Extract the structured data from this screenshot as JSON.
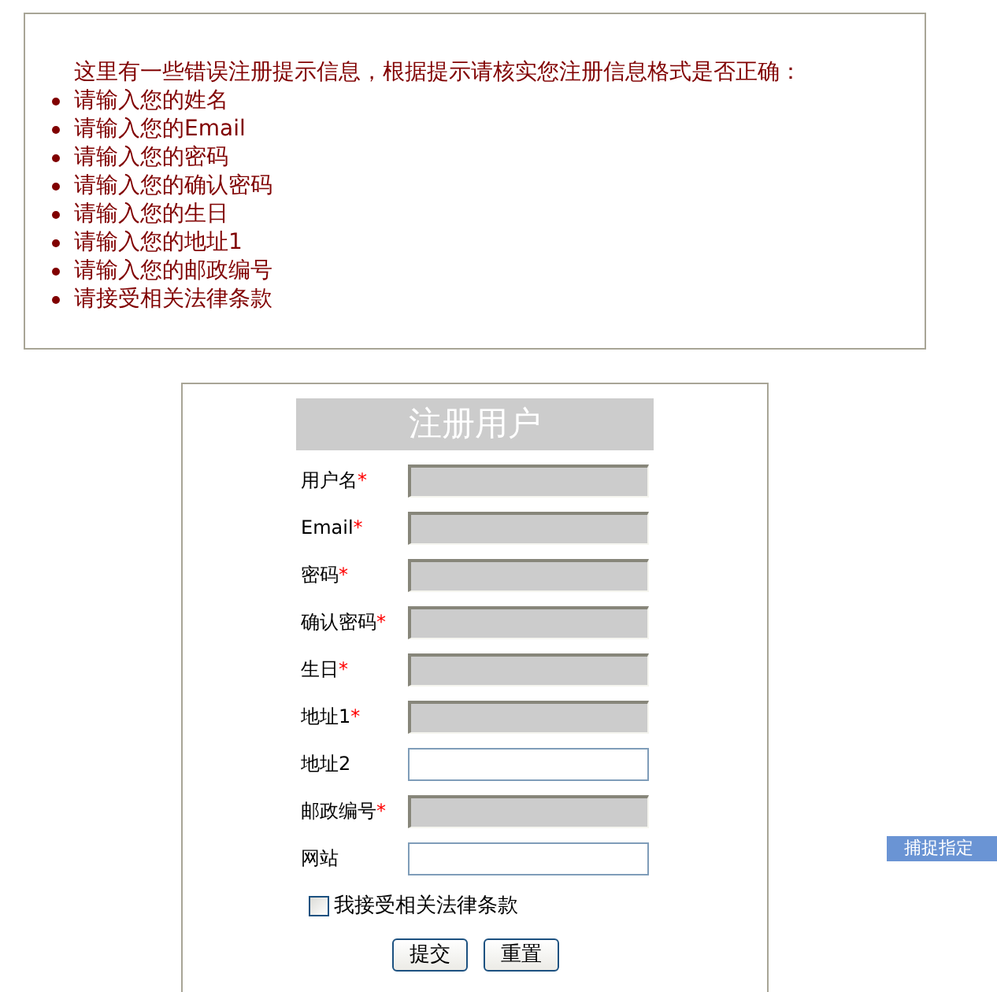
{
  "errors": {
    "intro": "这里有一些错误注册提示信息，根据提示请核实您注册信息格式是否正确：",
    "items": [
      "请输入您的姓名",
      "请输入您的Email",
      "请输入您的密码",
      "请输入您的确认密码",
      "请输入您的生日",
      "请输入您的地址1",
      "请输入您的邮政编号",
      "请接受相关法律条款"
    ]
  },
  "form": {
    "title": "注册用户",
    "fields": [
      {
        "label": "用户名",
        "required": true,
        "error": true
      },
      {
        "label": "Email",
        "required": true,
        "error": true
      },
      {
        "label": "密码",
        "required": true,
        "error": true
      },
      {
        "label": "确认密码",
        "required": true,
        "error": true
      },
      {
        "label": "生日",
        "required": true,
        "error": true
      },
      {
        "label": "地址1",
        "required": true,
        "error": true
      },
      {
        "label": "地址2",
        "required": false,
        "error": false
      },
      {
        "label": "邮政编号",
        "required": true,
        "error": true
      },
      {
        "label": "网站",
        "required": false,
        "error": false
      }
    ],
    "required_mark": "*",
    "agree": {
      "label": "我接受相关法律条款",
      "checked": false
    },
    "buttons": [
      "提交",
      "重置"
    ]
  },
  "capture_button": "捕捉指定"
}
